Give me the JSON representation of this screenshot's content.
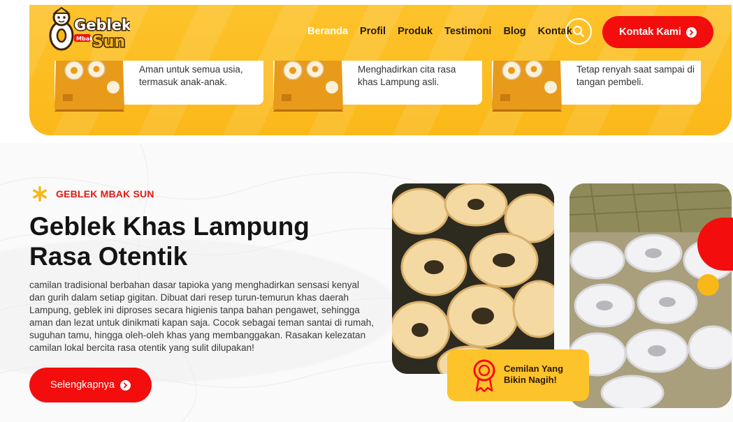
{
  "brand": {
    "logo_line1": "Geblek",
    "logo_small": "Mbak",
    "logo_line2": "Sun"
  },
  "nav": {
    "items": [
      {
        "label": "Beranda",
        "active": true
      },
      {
        "label": "Profil",
        "active": false
      },
      {
        "label": "Produk",
        "active": false
      },
      {
        "label": "Testimoni",
        "active": false
      },
      {
        "label": "Blog",
        "active": false
      },
      {
        "label": "Kontak",
        "active": false
      }
    ],
    "search_icon": "search-icon",
    "cta_label": "Kontak Kami"
  },
  "features": [
    {
      "text": "Aman untuk semua usia, termasuk anak-anak."
    },
    {
      "text": "Menghadirkan cita rasa khas Lampung asli."
    },
    {
      "text": "Tetap renyah saat sampai di tangan pembeli."
    }
  ],
  "about": {
    "eyebrow": "GEBLEK MBAK SUN",
    "title": "Geblek Khas Lampung Rasa Otentik",
    "description": "camilan tradisional berbahan dasar tapioka yang menghadirkan sensasi kenyal dan gurih dalam setiap gigitan. Dibuat dari resep turun-temurun khas daerah Lampung, geblek ini diproses secara higienis tanpa bahan pengawet, sehingga aman dan lezat untuk dinikmati kapan saja. Cocok sebagai teman santai di rumah, suguhan tamu, hingga oleh-oleh khas yang membanggakan. Rasakan kelezatan camilan lokal bercita rasa otentik yang sulit dilupakan!",
    "button_label": "Selengkapnya",
    "badge_text": "Cemilan Yang Bikin Nagih!"
  },
  "colors": {
    "brand_yellow": "#fdc32b",
    "accent_red": "#f40d0d",
    "text_dark": "#141414"
  }
}
